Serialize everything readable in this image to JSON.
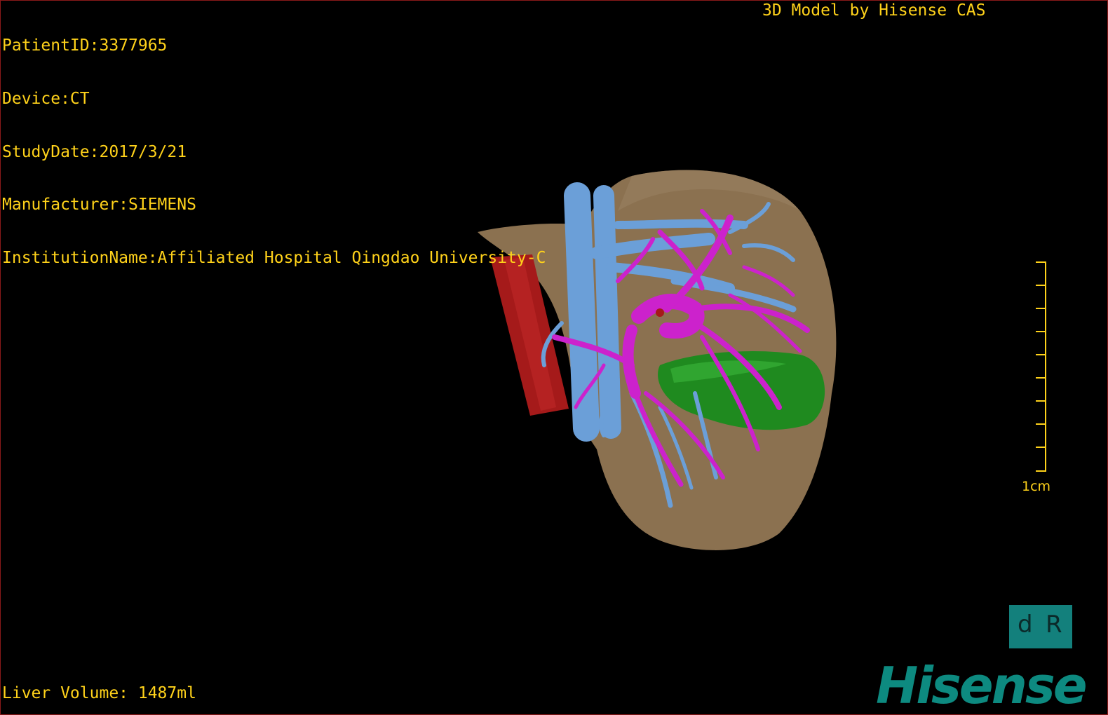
{
  "overlay": {
    "patient_id": "PatientID:3377965",
    "device": "Device:CT",
    "study_date": "StudyDate:2017/3/21",
    "manufacturer": "Manufacturer:SIEMENS",
    "institution": "InstitutionName:Affiliated Hospital Qingdao University-C",
    "credit": "3D Model by Hisense CAS",
    "liver_volume": "Liver Volume: 1487ml"
  },
  "scale": {
    "label": "1cm"
  },
  "orientation": {
    "left_face": "d",
    "right_face": "R"
  },
  "brand": {
    "logo_text": "Hisense"
  },
  "colors": {
    "text": "#ffd21a",
    "liver": "#8b7150",
    "hepatic_vein": "#6b9fd8",
    "portal_vein": "#cc22cc",
    "artery": "#a51a1a",
    "gallbladder": "#1f8a1f",
    "brand": "#0d8a80"
  }
}
